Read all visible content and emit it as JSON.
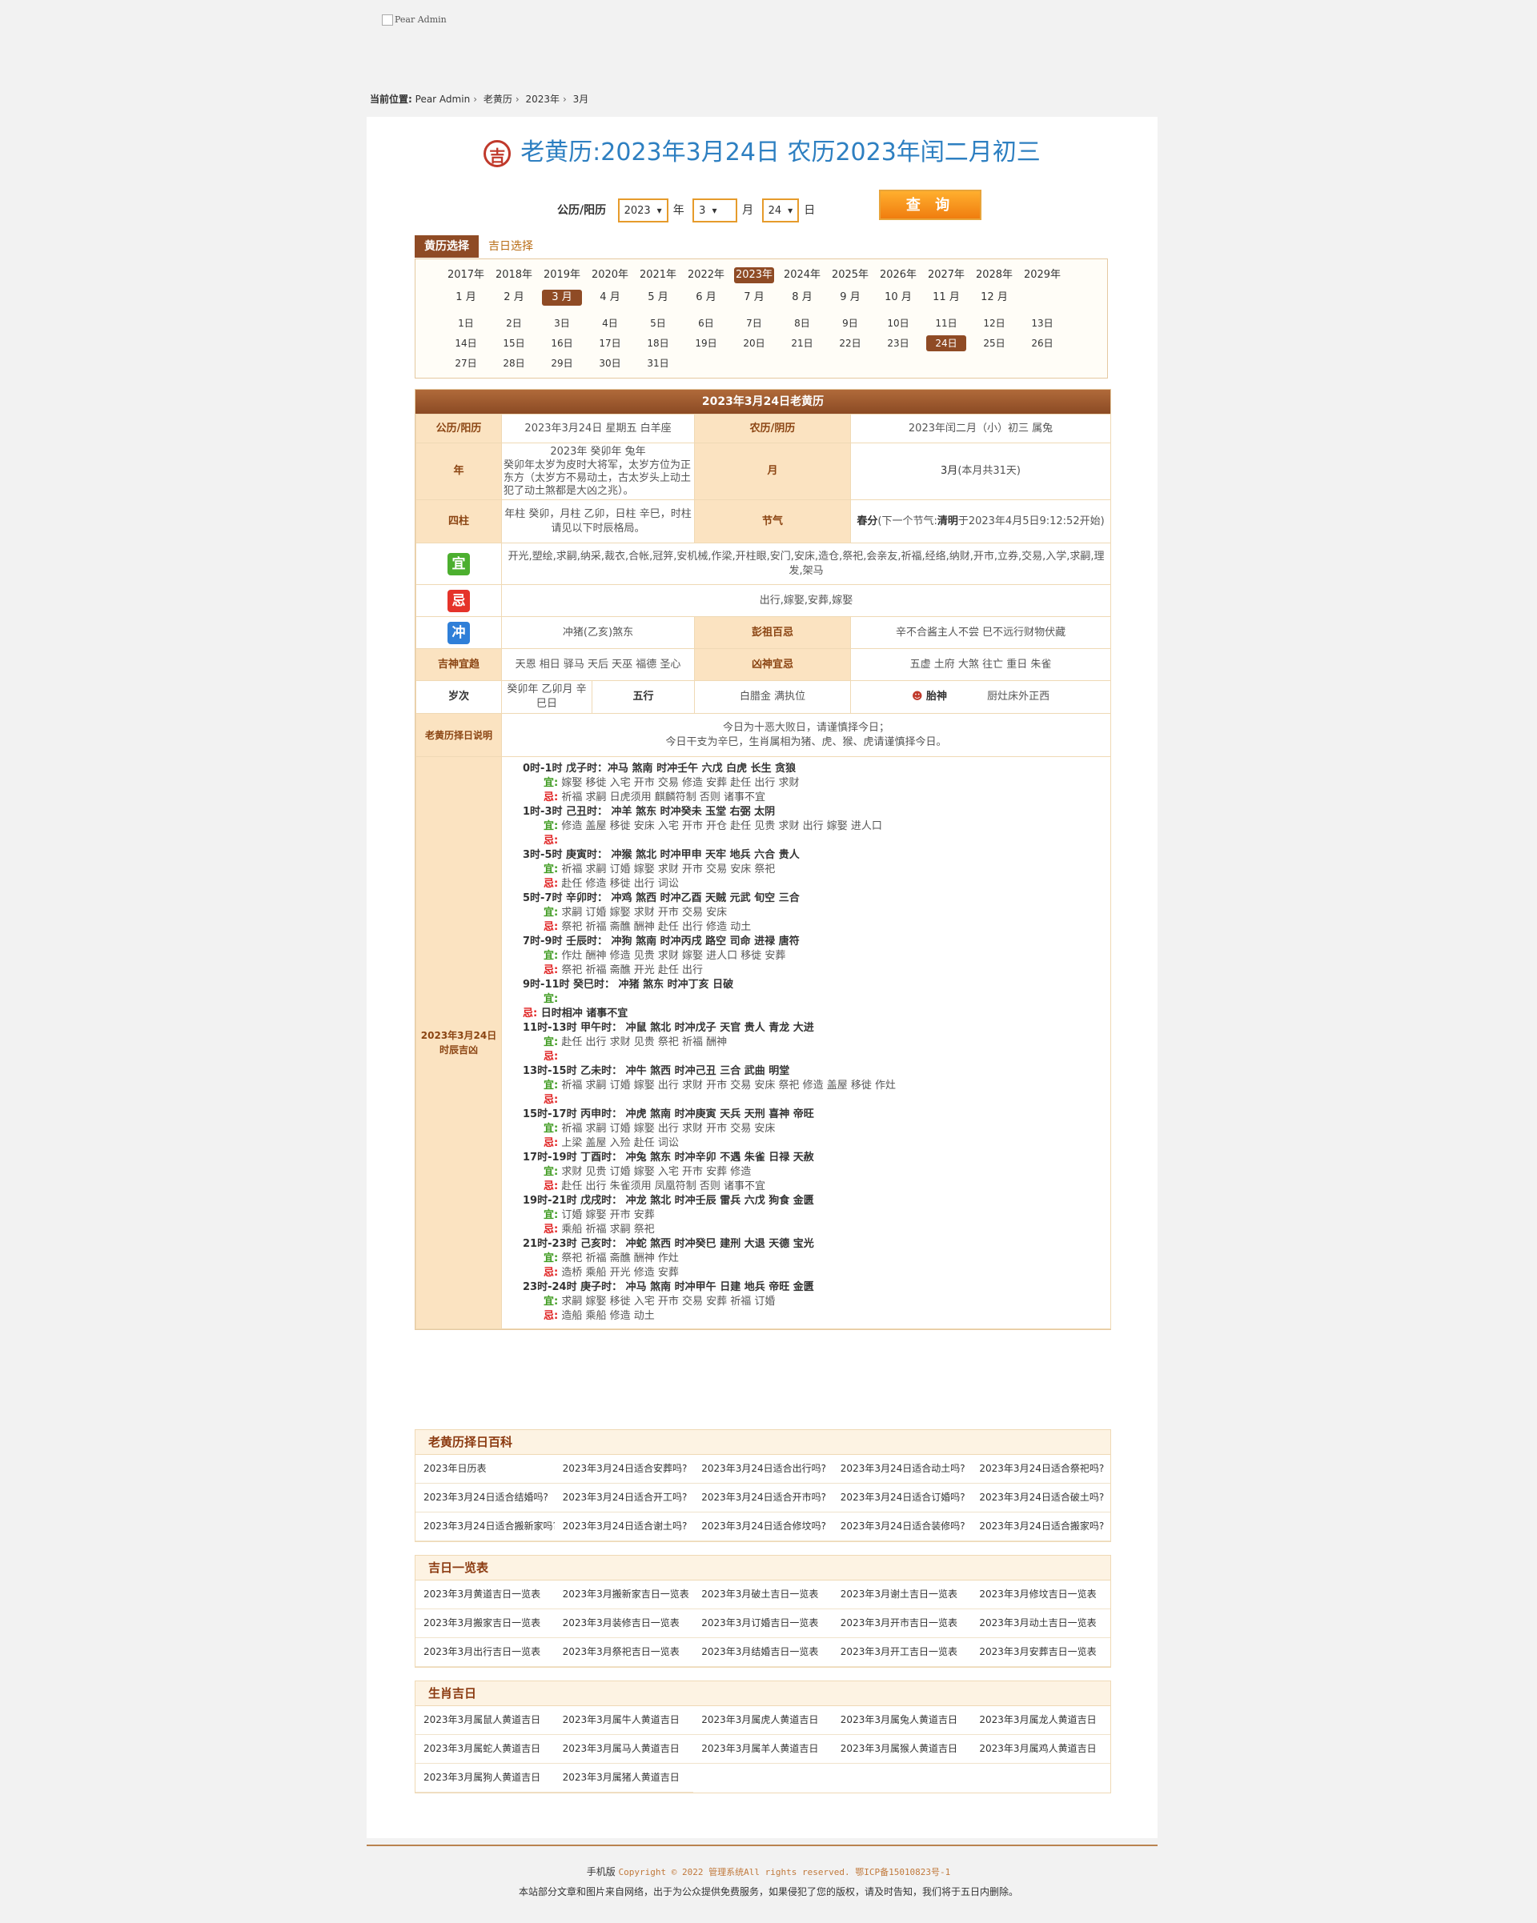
{
  "header": {
    "logo_alt": "Pear Admin"
  },
  "breadcrumb": {
    "prefix": "当前位置:",
    "items": [
      "Pear Admin",
      "老黄历",
      "2023年",
      "3月"
    ]
  },
  "title": {
    "icon_char": "吉",
    "text": "老黄历:2023年3月24日 农历2023年闰二月初三"
  },
  "query": {
    "label": "公历/阳历",
    "year": "2023",
    "year_unit": "年",
    "month": "3",
    "month_unit": "月",
    "day": "24",
    "day_unit": "日",
    "button": "查 询"
  },
  "tabs": [
    {
      "label": "黄历选择",
      "active": true
    },
    {
      "label": "吉日选择",
      "active": false
    }
  ],
  "picker": {
    "years": [
      "2017年",
      "2018年",
      "2019年",
      "2020年",
      "2021年",
      "2022年",
      "2023年",
      "2024年",
      "2025年",
      "2026年",
      "2027年",
      "2028年",
      "2029年"
    ],
    "months": [
      "1 月",
      "2 月",
      "3 月",
      "4 月",
      "5 月",
      "6 月",
      "7 月",
      "8 月",
      "9 月",
      "10 月",
      "11 月",
      "12 月"
    ],
    "days": [
      "1日",
      "2日",
      "3日",
      "4日",
      "5日",
      "6日",
      "7日",
      "8日",
      "9日",
      "10日",
      "11日",
      "12日",
      "13日",
      "14日",
      "15日",
      "16日",
      "17日",
      "18日",
      "19日",
      "20日",
      "21日",
      "22日",
      "23日",
      "24日",
      "25日",
      "26日",
      "27日",
      "28日",
      "29日",
      "30日",
      "31日"
    ],
    "selected_year": "2023年",
    "selected_month": "3 月",
    "selected_day": "24日"
  },
  "almanac": {
    "header": "2023年3月24日老黄历",
    "solar_label": "公历/阳历",
    "solar_value": "2023年3月24日 星期五 白羊座",
    "lunar_label": "农历/阴历",
    "lunar_value": "2023年闰二月（小）初三 属兔",
    "year_label": "年",
    "year_value": "2023年 癸卯年 兔年",
    "year_note": "癸卯年太岁为皮时大将军，太岁方位为正东方（太岁方不易动土，古太岁头上动土犯了动土煞都是大凶之兆）。",
    "month_label": "月",
    "month_value": "3月",
    "month_note": "(本月共31天)",
    "pillars_label": "四柱",
    "pillars_value": "年柱 癸卯，月柱 乙卯，日柱 辛巳，时柱请见以下时辰格局。",
    "jieqi_label": "节气",
    "jieqi_value": "春分",
    "jieqi_note": "(下一个节气:",
    "jieqi_next": "清明",
    "jieqi_next_note": "于2023年4月5日9:12:52开始)",
    "yi_badge": "宜",
    "yi_value": "开光,塑绘,求嗣,纳采,裁衣,合帐,冠笄,安机械,作梁,开柱眼,安门,安床,造仓,祭祀,会亲友,祈福,经络,纳财,开市,立券,交易,入学,求嗣,理发,架马",
    "ji_badge": "忌",
    "ji_value": "出行,嫁娶,安葬,嫁娶",
    "chong_badge": "冲",
    "chong_value": "冲猪(乙亥)煞东",
    "pengzu_label": "彭祖百忌",
    "pengzu_value": "辛不合酱主人不尝 巳不远行财物伏藏",
    "jishen_label": "吉神宜趋",
    "jishen_value": "天恩 相日 驿马 天后 天巫 福德 圣心",
    "xiongshen_label": "凶神宜忌",
    "xiongshen_value": "五虚 土府 大煞 往亡 重日 朱雀",
    "suici_label": "岁次",
    "suici_value": "癸卯年 乙卯月 辛巳日",
    "wuxing_label": "五行",
    "wuxing_value": "白腊金 满执位",
    "taishen_label": "胎神",
    "taishen_value": "厨灶床外正西",
    "note_label": "老黄历择日说明",
    "note_line1": "今日为十恶大败日，请谨慎择今日；",
    "note_line2": "今日干支为辛巳，生肖属相为猪、虎、猴、虎请谨慎择今日。",
    "hours_label": "2023年3月24日时辰吉凶",
    "hours": [
      {
        "hdr": "0时-1时 戊子时：冲马 煞南 时冲壬午 六戊 白虎 长生 贪狼",
        "yi": "嫁娶 移徙 入宅 开市 交易 修造 安葬 赴任 出行 求财",
        "ji": "祈福 求嗣 日虎须用 麒麟符制 否则 诸事不宜"
      },
      {
        "hdr": "1时-3时 己丑时：  冲羊 煞东 时冲癸未 玉堂 右弼 太阴",
        "yi": "修造 盖屋 移徙 安床 入宅 开市 开仓 赴任 见贵 求财 出行 嫁娶 进人口",
        "ji": ""
      },
      {
        "hdr": "3时-5时 庚寅时：  冲猴 煞北 时冲甲申 天牢 地兵 六合 贵人",
        "yi": "祈福 求嗣 订婚 嫁娶 求财 开市 交易 安床 祭祀",
        "ji": "赴任 修造 移徙 出行 词讼"
      },
      {
        "hdr": "5时-7时 辛卯时：  冲鸡 煞西 时冲乙酉 天贼 元武 旬空 三合",
        "yi": "求嗣 订婚 嫁娶 求财 开市 交易 安床",
        "ji": "祭祀 祈福 斋醮 酬神 赴任 出行 修造 动土"
      },
      {
        "hdr": "7时-9时 壬辰时：  冲狗 煞南 时冲丙戌 路空 司命 进禄 唐符",
        "yi": "作灶 酬神 修造 见贵 求财 嫁娶 进人口 移徙 安葬",
        "ji": "祭祀 祈福 斋醮 开光 赴任 出行"
      },
      {
        "hdr": "9时-11时 癸巳时：  冲猪 煞东 时冲丁亥 日破",
        "yi": "",
        "ji_inline": "日时相冲 诸事不宜"
      },
      {
        "hdr": "11时-13时 甲午时：  冲鼠 煞北 时冲戊子 天官 贵人 青龙 大进",
        "yi": "赴任 出行 求财 见贵 祭祀 祈福 酬神",
        "ji": ""
      },
      {
        "hdr": "13时-15时 乙未时：  冲牛 煞西 时冲己丑 三合 武曲 明堂",
        "yi": "祈福 求嗣 订婚 嫁娶 出行 求财 开市 交易 安床 祭祀 修造 盖屋 移徙 作灶",
        "ji": ""
      },
      {
        "hdr": "15时-17时 丙申时：  冲虎 煞南 时冲庚寅 天兵 天刑 喜神 帝旺",
        "yi": "祈福 求嗣 订婚 嫁娶 出行 求财 开市 交易 安床",
        "ji": "上梁 盖屋 入殓 赴任 词讼"
      },
      {
        "hdr": "17时-19时 丁酉时：  冲兔 煞东 时冲辛卯 不遇 朱雀 日禄 天赦",
        "yi": "求财 见贵 订婚 嫁娶 入宅 开市 安葬 修造",
        "ji": "赴任 出行 朱雀须用 凤凰符制 否则 诸事不宜"
      },
      {
        "hdr": "19时-21时 戊戌时：  冲龙 煞北 时冲壬辰 雷兵 六戊 狗食 金匮",
        "yi": "订婚 嫁娶 开市 安葬",
        "ji": "乘船 祈福 求嗣 祭祀"
      },
      {
        "hdr": "21时-23时 己亥时：  冲蛇 煞西 时冲癸巳 建刑 大退 天德 宝光",
        "yi": "祭祀 祈福 斋醮 酬神 作灶",
        "ji": "造桥 乘船 开光 修造 安葬"
      },
      {
        "hdr": "23时-24时 庚子时：  冲马 煞南 时冲甲午 日建 地兵 帝旺 金匮",
        "yi": "求嗣 嫁娶 移徙 入宅 开市 交易 安葬 祈福 订婚",
        "ji": "造船 乘船 修造 动土"
      }
    ],
    "yi_prefix": "宜:",
    "ji_prefix": "忌:"
  },
  "sections": [
    {
      "title": "老黄历择日百科",
      "items": [
        {
          "t": "2023年日历表",
          "c": "green"
        },
        {
          "t": "2023年3月24日适合安葬吗?",
          "c": ""
        },
        {
          "t": "2023年3月24日适合出行吗?",
          "c": ""
        },
        {
          "t": "2023年3月24日适合动土吗?",
          "c": "red"
        },
        {
          "t": "2023年3月24日适合祭祀吗?",
          "c": ""
        },
        {
          "t": "2023年3月24日适合结婚吗?",
          "c": "red"
        },
        {
          "t": "2023年3月24日适合开工吗?",
          "c": ""
        },
        {
          "t": "2023年3月24日适合开市吗?",
          "c": "blue"
        },
        {
          "t": "2023年3月24日适合订婚吗?",
          "c": "green"
        },
        {
          "t": "2023年3月24日适合破土吗?",
          "c": "red"
        },
        {
          "t": "2023年3月24日适合搬新家吗?",
          "c": ""
        },
        {
          "t": "2023年3月24日适合谢土吗?",
          "c": ""
        },
        {
          "t": "2023年3月24日适合修坟吗?",
          "c": ""
        },
        {
          "t": "2023年3月24日适合装修吗?",
          "c": ""
        },
        {
          "t": "2023年3月24日适合搬家吗?",
          "c": ""
        }
      ]
    },
    {
      "title": "吉日一览表",
      "items": [
        {
          "t": "2023年3月黄道吉日一览表",
          "c": ""
        },
        {
          "t": "2023年3月搬新家吉日一览表",
          "c": ""
        },
        {
          "t": "2023年3月破土吉日一览表",
          "c": ""
        },
        {
          "t": "2023年3月谢土吉日一览表",
          "c": ""
        },
        {
          "t": "2023年3月修坟吉日一览表",
          "c": ""
        },
        {
          "t": "2023年3月搬家吉日一览表",
          "c": ""
        },
        {
          "t": "2023年3月装修吉日一览表",
          "c": ""
        },
        {
          "t": "2023年3月订婚吉日一览表",
          "c": ""
        },
        {
          "t": "2023年3月开市吉日一览表",
          "c": "red"
        },
        {
          "t": "2023年3月动土吉日一览表",
          "c": "red"
        },
        {
          "t": "2023年3月出行吉日一览表",
          "c": ""
        },
        {
          "t": "2023年3月祭祀吉日一览表",
          "c": "red"
        },
        {
          "t": "2023年3月结婚吉日一览表",
          "c": "blue"
        },
        {
          "t": "2023年3月开工吉日一览表",
          "c": "green"
        },
        {
          "t": "2023年3月安葬吉日一览表",
          "c": ""
        }
      ]
    },
    {
      "title": "生肖吉日",
      "items": [
        {
          "t": "2023年3月属鼠人黄道吉日",
          "c": ""
        },
        {
          "t": "2023年3月属牛人黄道吉日",
          "c": ""
        },
        {
          "t": "2023年3月属虎人黄道吉日",
          "c": ""
        },
        {
          "t": "2023年3月属兔人黄道吉日",
          "c": ""
        },
        {
          "t": "2023年3月属龙人黄道吉日",
          "c": ""
        },
        {
          "t": "2023年3月属蛇人黄道吉日",
          "c": ""
        },
        {
          "t": "2023年3月属马人黄道吉日",
          "c": ""
        },
        {
          "t": "2023年3月属羊人黄道吉日",
          "c": ""
        },
        {
          "t": "2023年3月属猴人黄道吉日",
          "c": ""
        },
        {
          "t": "2023年3月属鸡人黄道吉日",
          "c": ""
        },
        {
          "t": "2023年3月属狗人黄道吉日",
          "c": ""
        },
        {
          "t": "2023年3月属猪人黄道吉日",
          "c": ""
        }
      ]
    }
  ],
  "footer": {
    "mobile": "手机版",
    "copyright": "Copyright © 2022 管理系统All rights reserved. 鄂ICP备15010823号-1",
    "disclaimer": "本站部分文章和图片来自网络，出于为公众提供免费服务，如果侵犯了您的版权，请及时告知，我们将于五日内删除。"
  }
}
